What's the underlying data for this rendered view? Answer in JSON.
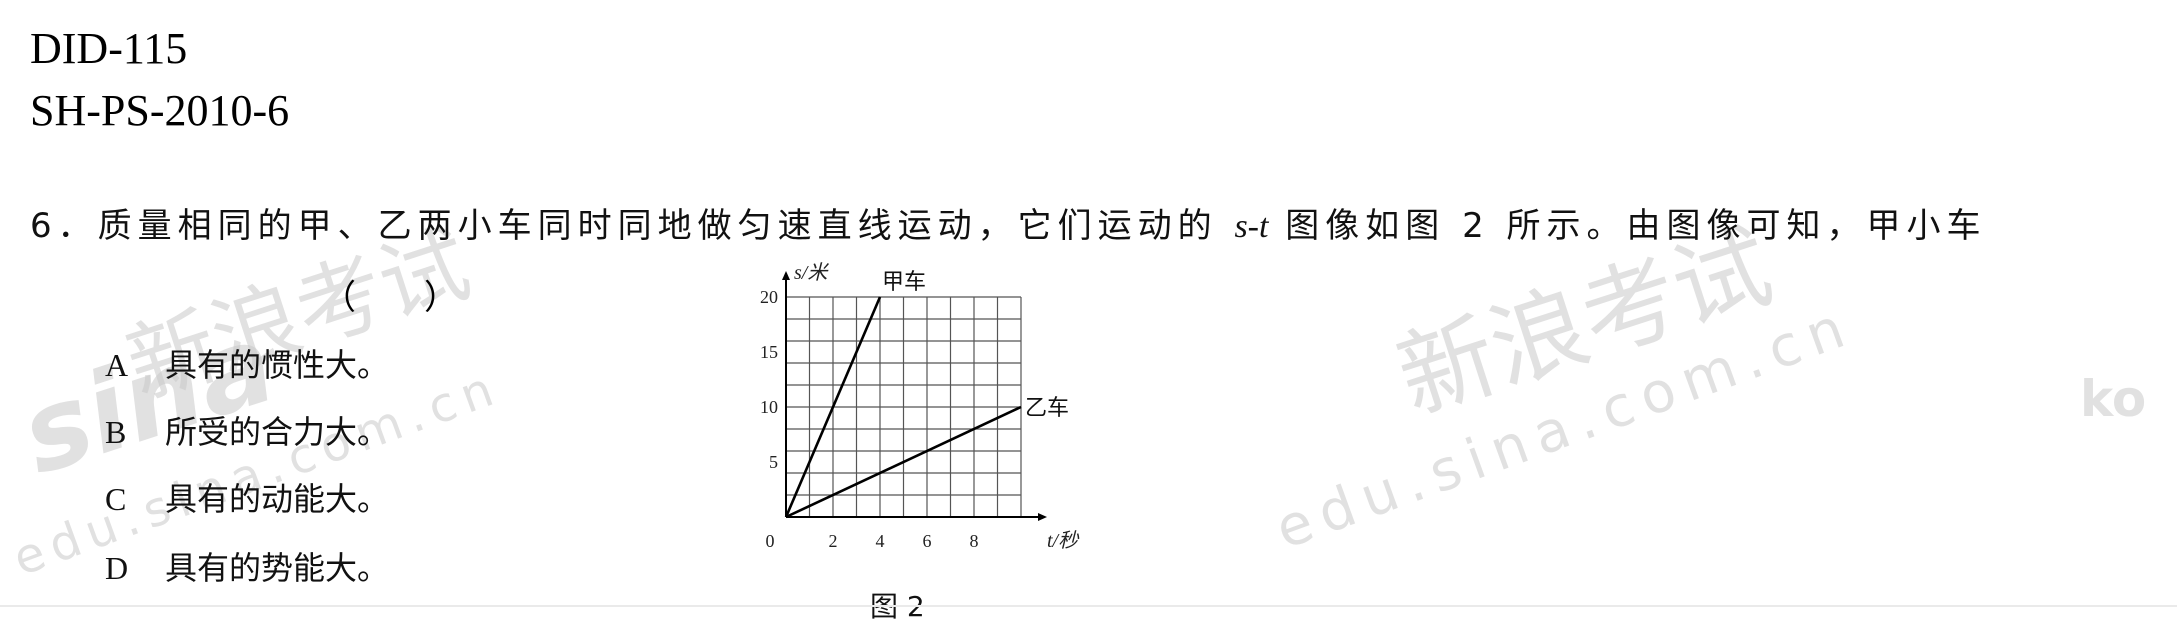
{
  "header": {
    "line1": "DID-115",
    "line2": "SH-PS-2010-6"
  },
  "question": {
    "text_before": "6．质量相同的甲、乙两小车同时同地做匀速直线运动，它们运动的",
    "st": "s-t",
    "text_after": "图像如图 2 所示。由图像可知，甲小车",
    "paren": "（　　）"
  },
  "options": [
    {
      "letter": "A",
      "text": "具有的惯性大。"
    },
    {
      "letter": "B",
      "text": "所受的合力大。"
    },
    {
      "letter": "C",
      "text": "具有的动能大。"
    },
    {
      "letter": "D",
      "text": "具有的势能大。"
    }
  ],
  "watermarks": [
    {
      "text": "新浪考试"
    },
    {
      "text": "sina"
    },
    {
      "text": "新浪考试"
    },
    {
      "text": "edu.sina.com.cn"
    },
    {
      "text": "edu.sina.com.cn"
    },
    {
      "text": "ko"
    }
  ],
  "figure_caption": "图 2",
  "chart_data": {
    "type": "line",
    "xlabel": "t/秒",
    "ylabel": "s/米",
    "xlim": [
      0,
      10
    ],
    "ylim": [
      0,
      20
    ],
    "xticks": [
      "0",
      "2",
      "4",
      "6",
      "8"
    ],
    "yticks": [
      "5",
      "10",
      "15",
      "20"
    ],
    "grid": true,
    "series": [
      {
        "name": "甲车",
        "x": [
          0,
          4
        ],
        "y": [
          0,
          20
        ]
      },
      {
        "name": "乙车",
        "x": [
          0,
          10
        ],
        "y": [
          0,
          10
        ]
      }
    ]
  }
}
